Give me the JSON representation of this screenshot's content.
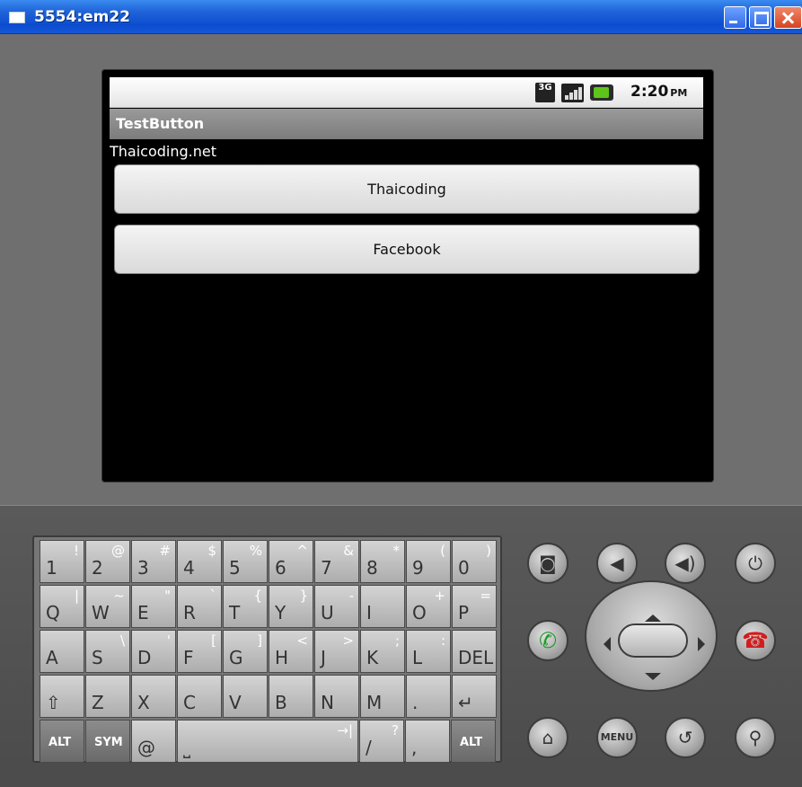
{
  "window": {
    "title": "5554:em22",
    "controls": [
      "minimize-icon",
      "maximize-icon",
      "close-icon"
    ]
  },
  "status_bar": {
    "network": "3G",
    "time": "2:20",
    "ampm": "PM",
    "icons": [
      "3g-icon",
      "signal-icon",
      "battery-icon"
    ]
  },
  "app": {
    "title": "TestButton",
    "label": "Thaicoding.net",
    "buttons": [
      "Thaicoding",
      "Facebook"
    ]
  },
  "keyboard": {
    "row1": [
      [
        "1",
        "!"
      ],
      [
        "2",
        "@"
      ],
      [
        "3",
        "#"
      ],
      [
        "4",
        "$"
      ],
      [
        "5",
        "%"
      ],
      [
        "6",
        "^"
      ],
      [
        "7",
        "&"
      ],
      [
        "8",
        "*"
      ],
      [
        "9",
        "("
      ],
      [
        "0",
        ")"
      ]
    ],
    "row2": [
      [
        "Q",
        "|"
      ],
      [
        "W",
        "~"
      ],
      [
        "E",
        "\""
      ],
      [
        "R",
        "`"
      ],
      [
        "T",
        "{"
      ],
      [
        "Y",
        "}"
      ],
      [
        "U",
        "-"
      ],
      [
        "I",
        ""
      ],
      [
        "O",
        "+"
      ],
      [
        "P",
        "="
      ]
    ],
    "row3": [
      [
        "A",
        ""
      ],
      [
        "S",
        "\\"
      ],
      [
        "D",
        "'"
      ],
      [
        "F",
        "["
      ],
      [
        "G",
        "]"
      ],
      [
        "H",
        "<"
      ],
      [
        "J",
        ">"
      ],
      [
        "K",
        ";"
      ],
      [
        "L",
        ":"
      ],
      [
        "DEL",
        ""
      ]
    ],
    "row4": [
      [
        "⇧",
        ""
      ],
      [
        "Z",
        ""
      ],
      [
        "X",
        ""
      ],
      [
        "C",
        ""
      ],
      [
        "V",
        ""
      ],
      [
        "B",
        ""
      ],
      [
        "N",
        ""
      ],
      [
        "M",
        ""
      ],
      [
        ".",
        ""
      ],
      [
        "↵",
        ""
      ]
    ],
    "row5": [
      [
        "ALT",
        ""
      ],
      [
        "SYM",
        ""
      ],
      [
        "@",
        ""
      ],
      [
        "⎵",
        "→|"
      ],
      [
        "/",
        "?"
      ],
      [
        ",",
        ""
      ],
      [
        "ALT",
        ""
      ]
    ]
  },
  "controls": {
    "top_row": [
      "camera-icon",
      "volume-down-icon",
      "volume-up-icon",
      "power-icon"
    ],
    "middle": [
      "call-icon",
      "dpad",
      "end-call-icon"
    ],
    "bottom_row": [
      "home-icon",
      "menu-button",
      "back-icon",
      "search-icon"
    ],
    "menu_label": "MENU"
  }
}
